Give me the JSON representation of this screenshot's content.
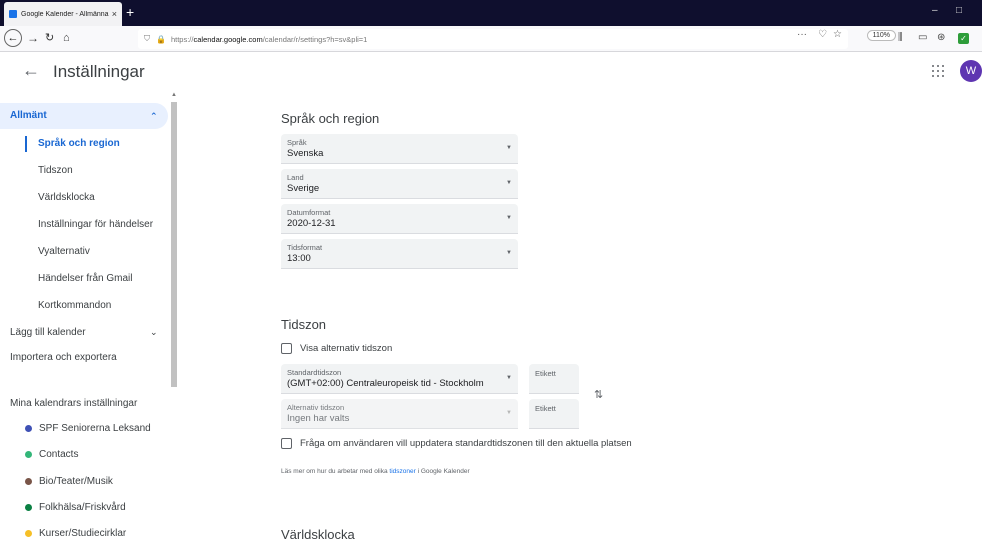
{
  "browser": {
    "tab_title": "Google Kalender - Allmänna in",
    "tab_close": "×",
    "new_tab": "+",
    "url_prefix": "https://",
    "url_domain": "calendar.google.com",
    "url_path": "/calendar/r/settings?h=sv&pli=1",
    "zoom": "110%",
    "url_more": "···",
    "window_minimize": "–",
    "window_maximize": "□"
  },
  "header": {
    "back": "←",
    "title": "Inställningar",
    "avatar_letter": "W",
    "avatar_color": "#5e35b1"
  },
  "sidebar": {
    "general": {
      "label": "Allmänt",
      "chevron": "⌃"
    },
    "sub_items": [
      {
        "label": "Språk och region",
        "active": true
      },
      {
        "label": "Tidszon"
      },
      {
        "label": "Världsklocka"
      },
      {
        "label": "Inställningar för händelser"
      },
      {
        "label": "Vyalternativ"
      },
      {
        "label": "Händelser från Gmail"
      },
      {
        "label": "Kortkommandon"
      }
    ],
    "add_calendar": {
      "label": "Lägg till kalender",
      "chevron": "⌄"
    },
    "import_export": "Importera och exportera",
    "my_calendars_heading": "Mina kalendrars inställningar",
    "calendars": [
      {
        "label": "SPF Seniorerna Leksand",
        "color": "#3f51b5"
      },
      {
        "label": "Contacts",
        "color": "#33b679"
      },
      {
        "label": "Bio/Teater/Musik",
        "color": "#795548"
      },
      {
        "label": "Folkhälsa/Friskvård",
        "color": "#0b8043"
      },
      {
        "label": "Kurser/Studiecirklar",
        "color": "#f6bf26"
      }
    ]
  },
  "main": {
    "lang_region": {
      "title": "Språk och region",
      "fields": [
        {
          "label": "Språk",
          "value": "Svenska"
        },
        {
          "label": "Land",
          "value": "Sverige"
        },
        {
          "label": "Datumformat",
          "value": "2020-12-31"
        },
        {
          "label": "Tidsformat",
          "value": "13:00"
        }
      ]
    },
    "timezone": {
      "title": "Tidszon",
      "show_alt_label": "Visa alternativ tidszon",
      "primary_label": "Standardtidszon",
      "primary_value": "(GMT+02:00) Centraleuropeisk tid - Stockholm",
      "alt_label": "Alternativ tidszon",
      "alt_value": "Ingen har valts",
      "etikett1": "Etikett",
      "etikett2": "Etikett",
      "ask_update_label": "Fråga om användaren vill uppdatera standardtidszonen till den aktuella platsen",
      "learn_prefix": "Läs mer om hur du arbetar med olika ",
      "learn_link": "tidszoner",
      "learn_suffix": " i Google Kalender"
    },
    "world_clock": {
      "title": "Världsklocka"
    }
  }
}
